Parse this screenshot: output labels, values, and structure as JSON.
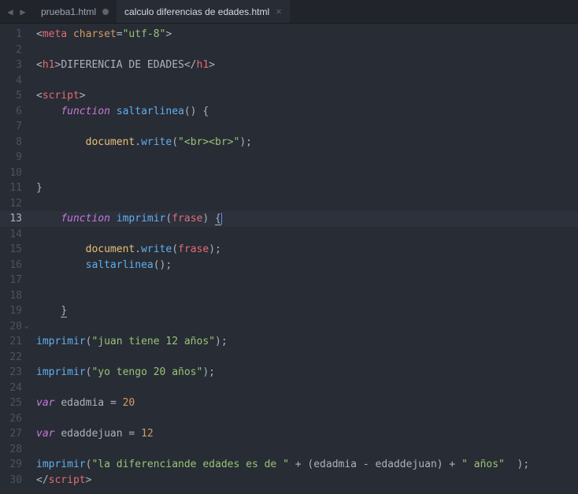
{
  "tabs": [
    {
      "name": "prueba1.html",
      "active": false,
      "dirty": true
    },
    {
      "name": "calculo diferencias de edades.html",
      "active": true,
      "dirty": false
    }
  ],
  "current_line": 13,
  "fold_markers_at": [
    20
  ],
  "code": {
    "l1": {
      "meta": "meta",
      "charset_attr": "charset",
      "charset_val": "\"utf-8\""
    },
    "l3": {
      "h1": "h1",
      "text": "DIFERENCIA DE EDADES"
    },
    "l5": {
      "script": "script"
    },
    "l6": {
      "function": "function",
      "name": "saltarlinea"
    },
    "l8": {
      "document": "document",
      "write": "write",
      "arg": "\"<br><br>\""
    },
    "l13": {
      "function": "function",
      "name": "imprimir",
      "param": "frase"
    },
    "l15": {
      "document": "document",
      "write": "write",
      "arg": "frase"
    },
    "l16": {
      "call": "saltarlinea"
    },
    "l21": {
      "fn": "imprimir",
      "arg": "\"juan tiene 12 años\""
    },
    "l23": {
      "fn": "imprimir",
      "arg": "\"yo tengo 20 años\""
    },
    "l25": {
      "var": "var",
      "name": "edadmia",
      "val": "20"
    },
    "l27": {
      "var": "var",
      "name": "edaddejuan",
      "val": "12"
    },
    "l29": {
      "fn": "imprimir",
      "s1": "\"la diferenciande edades es de \"",
      "v1": "edadmia",
      "v2": "edaddejuan",
      "s2": "\" años\""
    },
    "l30": {
      "script": "script"
    }
  }
}
